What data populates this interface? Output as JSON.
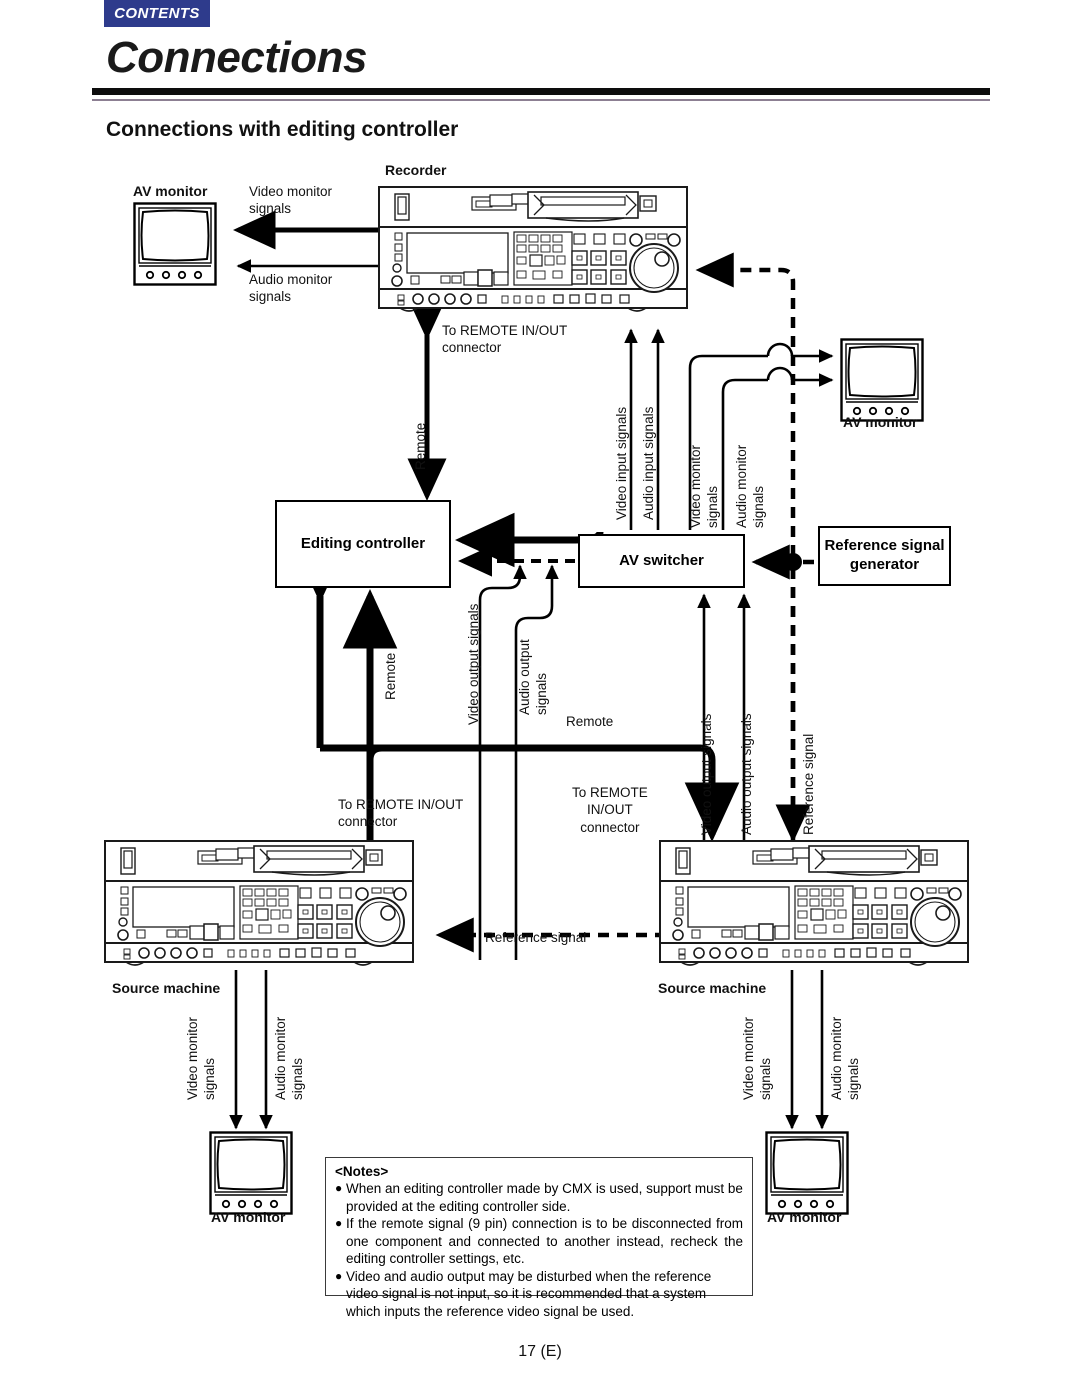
{
  "header": {
    "contents_tab": "CONTENTS",
    "title": "Connections",
    "section_title": "Connections with editing controller"
  },
  "footer": {
    "page_number": "17 (E)"
  },
  "diagram": {
    "boxes": {
      "editing_controller": "Editing controller",
      "av_switcher": "AV switcher",
      "reference_signal_generator": "Reference signal\ngenerator"
    },
    "device_labels": {
      "recorder": "Recorder",
      "source_machine_left": "Source machine",
      "source_machine_right": "Source machine",
      "av_monitor_top_left": "AV monitor",
      "av_monitor_top_right": "AV monitor",
      "av_monitor_bottom_left": "AV monitor",
      "av_monitor_bottom_right": "AV monitor"
    },
    "signal_labels": {
      "video_monitor_signals_top": "Video monitor\nsignals",
      "audio_monitor_signals_top": "Audio monitor\nsignals",
      "to_remote_in_out_recorder": "To REMOTE IN/OUT\nconnector",
      "remote_recorder": "Remote",
      "video_input_signals": "Video input signals",
      "audio_input_signals": "Audio input signals",
      "video_monitor_signals_right": "Video monitor\nsignals",
      "audio_monitor_signals_right": "Audio monitor\nsignals",
      "video_output_signals_left": "Video output signals",
      "audio_output_signals_left": "Audio output\nsignals",
      "remote_source_left": "Remote",
      "remote_source_right": "Remote",
      "to_remote_in_out_left": "To REMOTE IN/OUT\nconnector",
      "to_remote_in_out_right": "To REMOTE\nIN/OUT\nconnector",
      "video_output_signals_right": "Video output signals",
      "audio_output_signals_right": "Audio output signals",
      "reference_signal_vertical": "Reference signal",
      "reference_signal_horizontal": "Reference signal",
      "video_monitor_signals_bl": "Video monitor\nsignals",
      "audio_monitor_signals_bl": "Audio monitor\nsignals",
      "video_monitor_signals_br": "Video monitor\nsignals",
      "audio_monitor_signals_br": "Audio monitor\nsignals"
    }
  },
  "notes": {
    "title": "<Notes>",
    "bullet": "●",
    "items": [
      "When an editing controller made by CMX is used, support must be provided at the editing controller side.",
      "If the remote signal (9 pin) connection is to be disconnected from one component and connected to another instead, recheck the editing controller settings, etc.",
      "Video and audio output may be disturbed when the reference video signal is not input, so it is recommended that a system which inputs the reference video signal be used."
    ]
  },
  "colors": {
    "tab_background": "#2e3b8c",
    "rule_thick": "#0d0d0d",
    "rule_thin": "#8c7f92",
    "line": "#000000"
  }
}
